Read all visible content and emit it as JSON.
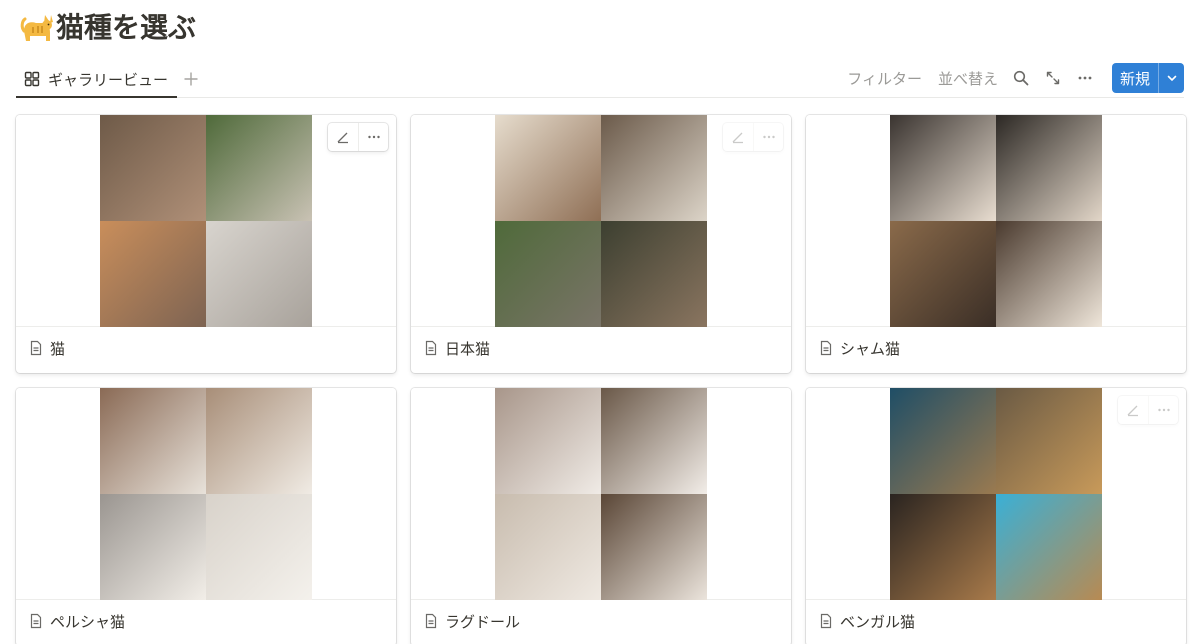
{
  "page": {
    "title": "猫種を選ぶ",
    "title_icon": "cat-emoji-icon"
  },
  "view_tabs": [
    {
      "label": "ギャラリービュー",
      "icon": "gallery-grid-icon",
      "active": true
    }
  ],
  "toolbar": {
    "filter_label": "フィルター",
    "sort_label": "並べ替え",
    "search_icon": "search-icon",
    "expand_icon": "expand-icon",
    "more_icon": "more-icon",
    "new_label": "新規",
    "accent": "#2f80d6"
  },
  "cards": [
    {
      "name": "猫",
      "icon": "page-icon",
      "cover_colors": [
        "#8a7360",
        "#6d7f52",
        "#b8855b",
        "#cfc9c2"
      ]
    },
    {
      "name": "日本猫",
      "icon": "page-icon",
      "cover_colors": [
        "#b39a7d",
        "#8f6f55",
        "#5e6650",
        "#4a4a3e"
      ]
    },
    {
      "name": "シャム猫",
      "icon": "page-icon",
      "cover_colors": [
        "#5c5048",
        "#4b4036",
        "#7a5f48",
        "#6a5848"
      ]
    },
    {
      "name": "ペルシャ猫",
      "icon": "page-icon",
      "cover_colors": [
        "#b8a08c",
        "#c9b8a5",
        "#d5ccc2",
        "#c7c3bd"
      ]
    },
    {
      "name": "ラグドール",
      "icon": "page-icon",
      "cover_colors": [
        "#c9bcae",
        "#bfb2a4",
        "#b9aa9a",
        "#8f7a66"
      ]
    },
    {
      "name": "ベンガル猫",
      "icon": "page-icon",
      "cover_colors": [
        "#2f5870",
        "#7e6a4c",
        "#4d3d2c",
        "#3ab0d6"
      ]
    }
  ],
  "card_actions": {
    "edit_icon": "edit-icon",
    "more_icon": "more-icon"
  }
}
